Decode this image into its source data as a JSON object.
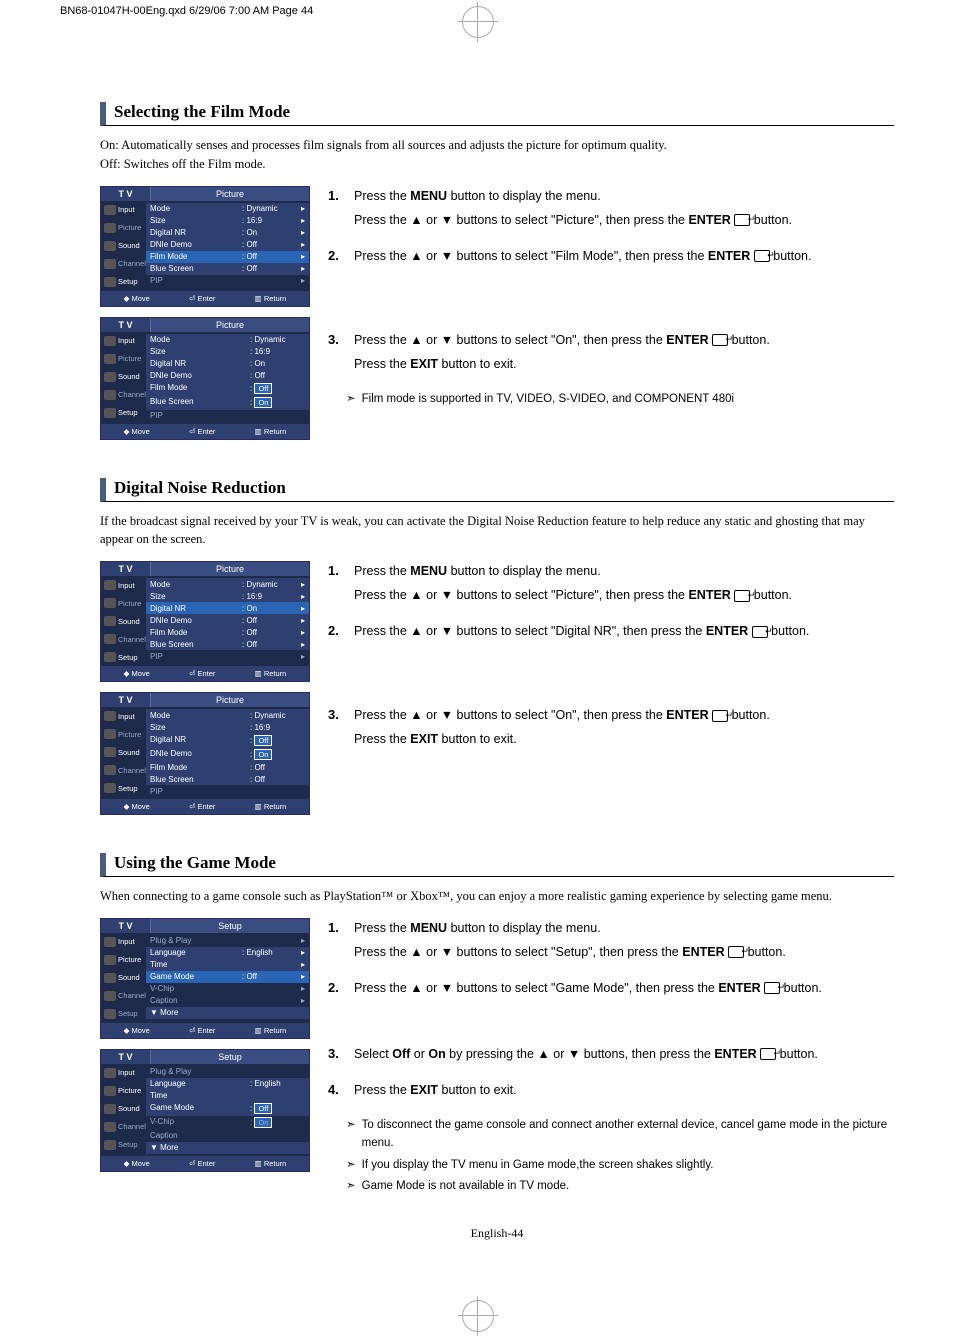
{
  "qxd": "BN68-01047H-00Eng.qxd  6/29/06 7:00 AM  Page 44",
  "s1": {
    "title": "Selecting the Film Mode",
    "intro": "On: Automatically senses and processes film signals from all sources and adjusts the picture for optimum quality.\nOff: Switches off the Film mode.",
    "osd1_title": "Picture",
    "osd2_title": "Picture",
    "step1a": "Press the <b>MENU</b> button to display the menu.",
    "step1b": "Press the ▲ or ▼ buttons to select \"Picture\", then press the <b>ENTER</b> <span class='enter-ico'></span>  button.",
    "step2": "Press the ▲ or ▼ buttons to select \"Film Mode\", then press the <b>ENTER</b> <span class='enter-ico'></span>  button.",
    "step3a": "Press the ▲ or ▼ buttons to select \"On\", then press the <b>ENTER</b> <span class='enter-ico'></span>  button.",
    "step3b": "Press the <b>EXIT</b> button to exit.",
    "note1": "Film mode is supported in TV, VIDEO, S-VIDEO, and COMPONENT 480i"
  },
  "s2": {
    "title": "Digital Noise Reduction",
    "intro": "If the broadcast signal received by your TV is weak, you can activate the Digital Noise Reduction feature to help reduce any static and ghosting that may appear on the screen.",
    "step1a": "Press the <b>MENU</b> button to display the menu.",
    "step1b": "Press the ▲ or ▼ buttons to select \"Picture\", then press the <b>ENTER</b> <span class='enter-ico'></span>  button.",
    "step2": "Press the ▲ or ▼ buttons to select \"Digital NR\", then press the <b>ENTER</b> <span class='enter-ico'></span>  button.",
    "step3a": "Press the ▲ or ▼ buttons to select \"On\", then press the <b>ENTER</b> <span class='enter-ico'></span>  button.",
    "step3b": "Press the <b>EXIT</b> button to exit."
  },
  "s3": {
    "title": "Using the Game Mode",
    "intro": "When connecting to a game console such as PlayStation™ or Xbox™, you can enjoy a more realistic gaming experience by selecting game menu.",
    "osd_title": "Setup",
    "step1a": "Press the <b>MENU</b> button to display the menu.",
    "step1b": "Press the ▲ or ▼ buttons to select \"Setup\", then press the <b>ENTER</b> <span class='enter-ico'></span>  button.",
    "step2": "Press the ▲ or ▼ buttons to select \"Game Mode\", then press the <b>ENTER</b> <span class='enter-ico'></span>  button.",
    "step3": "Select <b>Off</b> or <b>On</b> by pressing the ▲ or ▼ buttons, then press the <b>ENTER</b> <span class='enter-ico'></span>  button.",
    "step4": "Press the <b>EXIT</b> button to exit.",
    "note1": "To disconnect the game console and connect another external device, cancel game mode in the picture menu.",
    "note2": "If you display the TV menu in Game mode,the screen shakes slightly.",
    "note3": "Game Mode is not available in TV mode."
  },
  "osd": {
    "nav": [
      "Input",
      "Picture",
      "Sound",
      "Channel",
      "Setup"
    ],
    "pic_rows": [
      {
        "l": "Mode",
        "v": ": Dynamic"
      },
      {
        "l": "Size",
        "v": ": 16:9"
      },
      {
        "l": "Digital NR",
        "v": ": On"
      },
      {
        "l": "DNIe Demo",
        "v": ": Off"
      },
      {
        "l": "Film Mode",
        "v": ": Off"
      },
      {
        "l": "Blue Screen",
        "v": ": Off"
      },
      {
        "l": "PIP",
        "v": ""
      }
    ],
    "setup_rows": [
      {
        "l": "Plug & Play",
        "v": ""
      },
      {
        "l": "Language",
        "v": ": English"
      },
      {
        "l": "Time",
        "v": ""
      },
      {
        "l": "Game Mode",
        "v": ": Off"
      },
      {
        "l": "V-Chip",
        "v": ""
      },
      {
        "l": "Caption",
        "v": ""
      },
      {
        "l": "▼  More",
        "v": ""
      }
    ],
    "foot": {
      "move": "◆ Move",
      "enter": "⏎ Enter",
      "return": "▥ Return"
    }
  },
  "pg": "English-44"
}
